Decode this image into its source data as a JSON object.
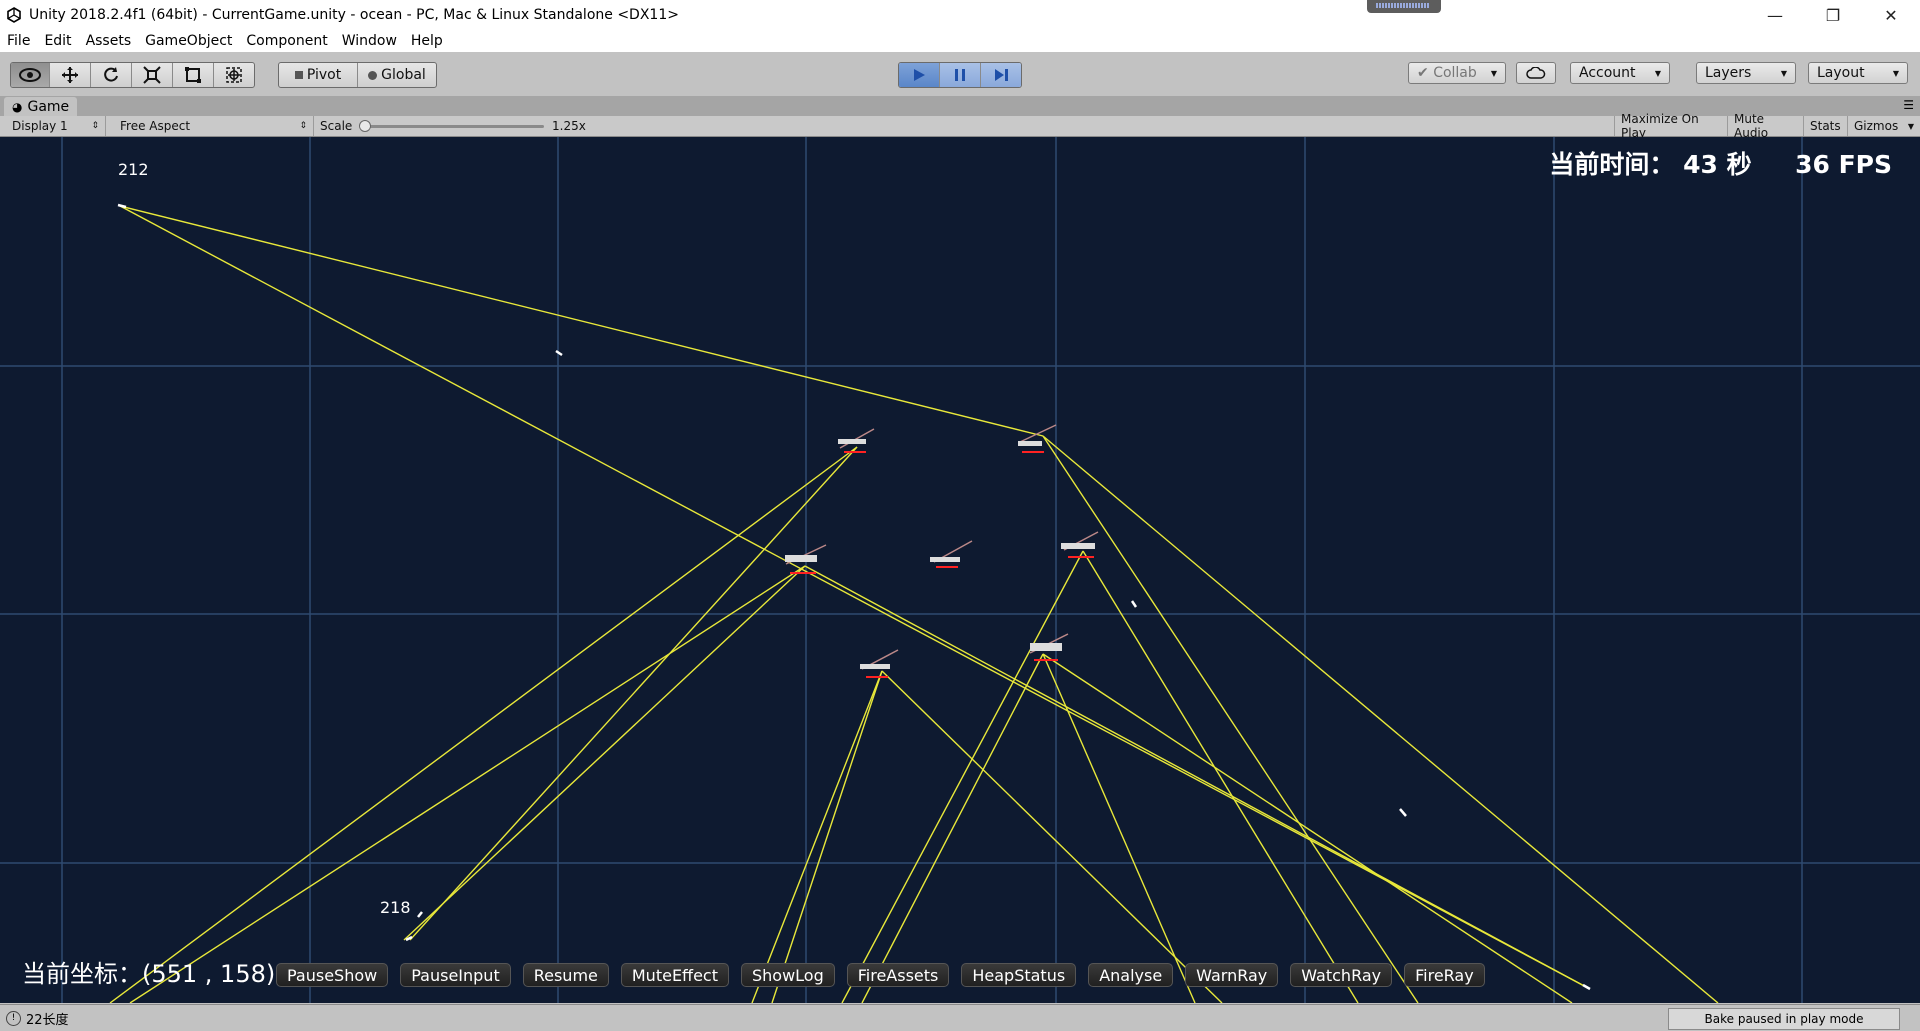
{
  "window": {
    "title": "Unity 2018.2.4f1 (64bit) - CurrentGame.unity - ocean - PC, Mac & Linux Standalone <DX11>",
    "controls": [
      "minimize",
      "restore",
      "close"
    ]
  },
  "menu": [
    "File",
    "Edit",
    "Assets",
    "GameObject",
    "Component",
    "Window",
    "Help"
  ],
  "toolbar": {
    "pivot_label": "Pivot",
    "global_label": "Global",
    "collab_label": "Collab",
    "account_label": "Account",
    "layers_label": "Layers",
    "layout_label": "Layout"
  },
  "game_tab": {
    "title": "Game"
  },
  "game_controls": {
    "display": "Display 1",
    "aspect": "Free Aspect",
    "scale_label": "Scale",
    "scale_value": "1.25x",
    "maximize": "Maximize On Play",
    "mute": "Mute Audio",
    "stats": "Stats",
    "gizmos": "Gizmos"
  },
  "hud": {
    "time_text": "当前时间： 43 秒     36 FPS",
    "coord_text": "当前坐标：(551 , 158)",
    "node_top_label": "212",
    "node_bottom_label": "218",
    "buttons": [
      "PauseShow",
      "PauseInput",
      "Resume",
      "MuteEffect",
      "ShowLog",
      "FireAssets",
      "HeapStatus",
      "Analyse",
      "WarnRay",
      "WatchRay",
      "FireRay"
    ]
  },
  "status": {
    "message": "22长度",
    "bake": "Bake paused in play mode"
  },
  "colors": {
    "viewport_bg": "#0e1a30",
    "grid": "#2e4a70",
    "ray": "#e8e83a",
    "marker": "#ff2222",
    "play_active": "#5a86c9"
  }
}
